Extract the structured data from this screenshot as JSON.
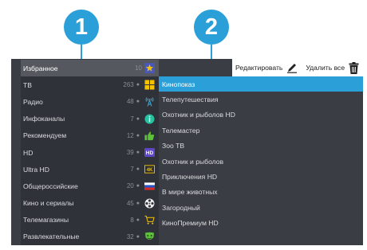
{
  "callouts": [
    "1",
    "2"
  ],
  "categories": [
    {
      "label": "Избранное",
      "count": "10",
      "icon": "star-icon",
      "active": true
    },
    {
      "label": "ТВ",
      "count": "263",
      "icon": "grid-icon"
    },
    {
      "label": "Радио",
      "count": "48",
      "icon": "radio-antenna-icon"
    },
    {
      "label": "Инфоканалы",
      "count": "7",
      "icon": "info-icon"
    },
    {
      "label": "Рекомендуем",
      "count": "12",
      "icon": "thumbs-up-icon"
    },
    {
      "label": "HD",
      "count": "39",
      "icon": "hd-icon"
    },
    {
      "label": "Ultra HD",
      "count": "7",
      "icon": "4k-icon"
    },
    {
      "label": "Общероссийские",
      "count": "20",
      "icon": "russian-flag-icon"
    },
    {
      "label": "Кино и сериалы",
      "count": "45",
      "icon": "film-reel-icon"
    },
    {
      "label": "Телемагазины",
      "count": "8",
      "icon": "shopping-cart-icon"
    },
    {
      "label": "Развлекательные",
      "count": "32",
      "icon": "theater-mask-icon"
    }
  ],
  "toolbar": {
    "edit_label": "Редактировать",
    "delete_all_label": "Удалить все"
  },
  "channels": [
    {
      "label": "Кинопоказ",
      "active": true
    },
    {
      "label": "Телепутешествия"
    },
    {
      "label": "Охотник и рыболов HD"
    },
    {
      "label": "Телемастер"
    },
    {
      "label": "Зоо ТВ"
    },
    {
      "label": "Охотник и рыболов"
    },
    {
      "label": "Приключения HD"
    },
    {
      "label": "В мире животных"
    },
    {
      "label": "Загородный"
    },
    {
      "label": "КиноПремиум HD"
    }
  ],
  "colors": {
    "callout": "#2ba0d8",
    "selected_channel": "#2ba0d8",
    "panel_bg": "#3a3d43",
    "category_bg": "#2f3238",
    "category_active_bg": "#55585e"
  },
  "dot_glyph": "●"
}
